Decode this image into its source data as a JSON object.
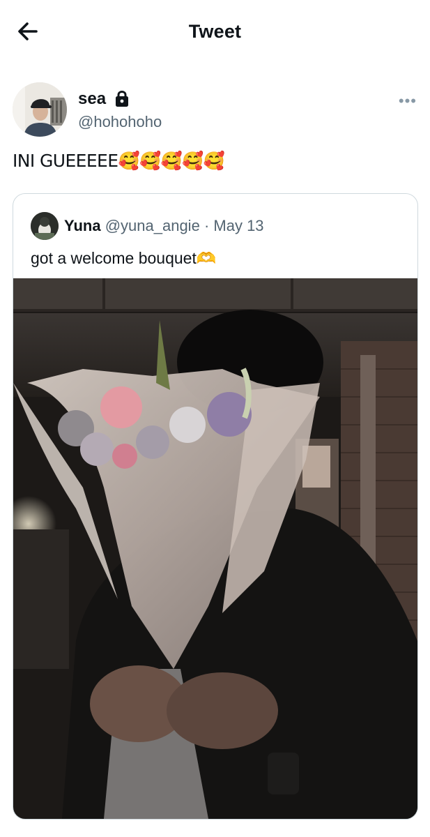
{
  "header": {
    "title": "Tweet"
  },
  "tweet": {
    "author_name": "sea",
    "author_handle": "@hohohoho",
    "text": "INI GUEEEEE🥰🥰🥰🥰🥰"
  },
  "quoted_tweet": {
    "author_name": "Yuna",
    "author_handle": "@yuna_angie",
    "separator": "·",
    "date": "May 13",
    "text": "got a welcome bouquet🫶"
  },
  "icons": {
    "back": "arrow-left-icon",
    "lock": "lock-icon",
    "more": "more-horizontal-icon"
  },
  "colors": {
    "text_primary": "#0f1419",
    "text_secondary": "#536471",
    "border": "#cfd9de"
  }
}
